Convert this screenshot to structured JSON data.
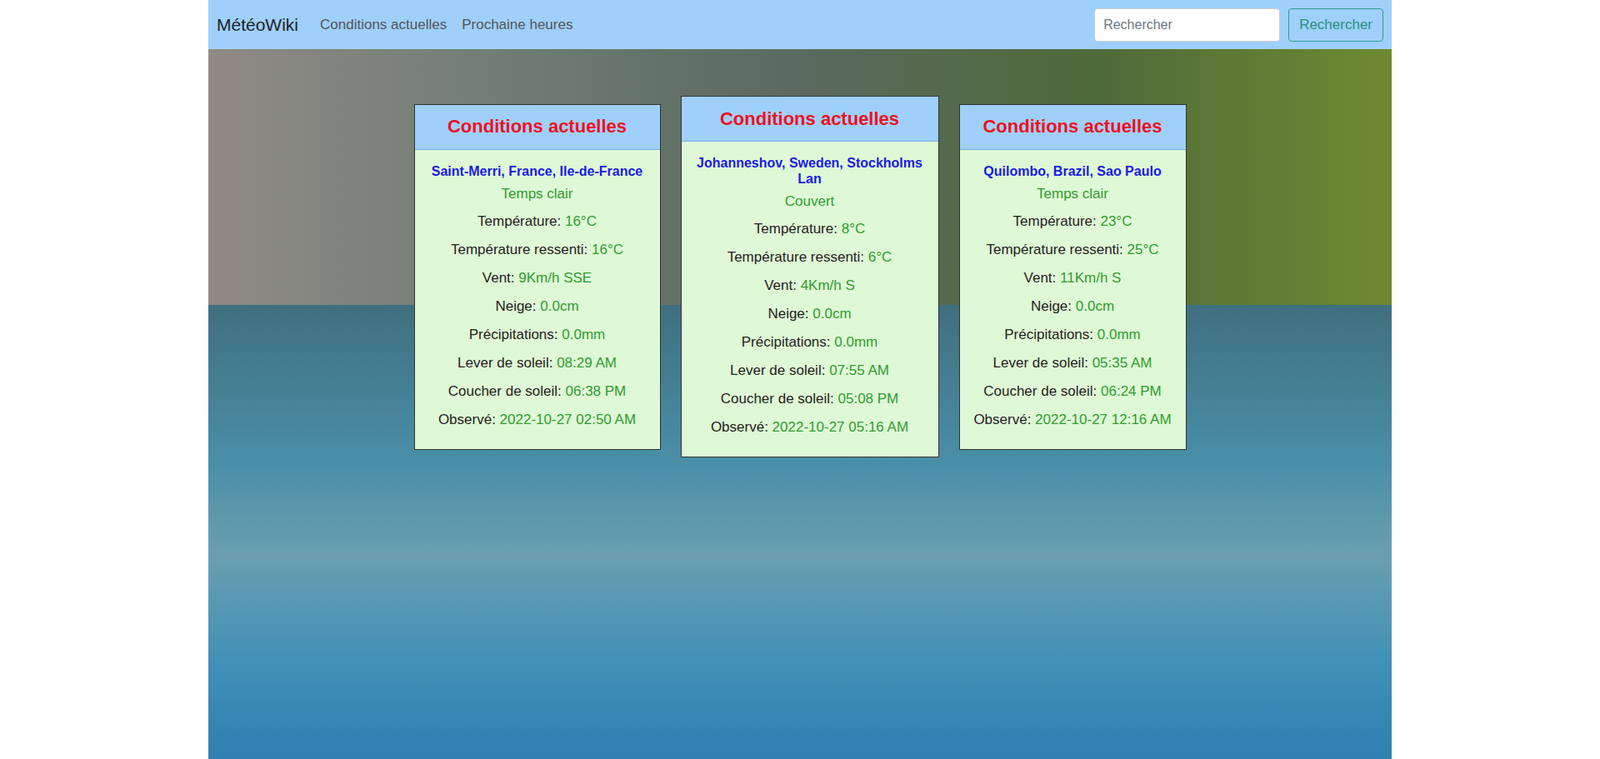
{
  "navbar": {
    "brand": "MétéoWiki",
    "links": [
      "Conditions actuelles",
      "Prochaine heures"
    ]
  },
  "search": {
    "placeholder": "Rechercher",
    "button": "Rechercher"
  },
  "cards": [
    {
      "title": "Conditions actuelles",
      "location": "Saint-Merri, France, Ile-de-France",
      "condition": "Temps clair",
      "fields": [
        {
          "label": "Température: ",
          "value": "16°C"
        },
        {
          "label": "Température ressenti: ",
          "value": "16°C"
        },
        {
          "label": "Vent: ",
          "value": "9Km/h SSE"
        },
        {
          "label": "Neige: ",
          "value": "0.0cm"
        },
        {
          "label": "Précipitations: ",
          "value": "0.0mm"
        },
        {
          "label": "Lever de soleil: ",
          "value": "08:29 AM"
        },
        {
          "label": "Coucher de soleil: ",
          "value": "06:38 PM"
        },
        {
          "label": "Observé: ",
          "value": "2022-10-27 02:50 AM"
        }
      ]
    },
    {
      "title": "Conditions actuelles",
      "location": "Johanneshov, Sweden, Stockholms Lan",
      "condition": "Couvert",
      "fields": [
        {
          "label": "Température: ",
          "value": "8°C"
        },
        {
          "label": "Température ressenti: ",
          "value": "6°C"
        },
        {
          "label": "Vent: ",
          "value": "4Km/h S"
        },
        {
          "label": "Neige: ",
          "value": "0.0cm"
        },
        {
          "label": "Précipitations: ",
          "value": "0.0mm"
        },
        {
          "label": "Lever de soleil: ",
          "value": "07:55 AM"
        },
        {
          "label": "Coucher de soleil: ",
          "value": "05:08 PM"
        },
        {
          "label": "Observé: ",
          "value": "2022-10-27 05:16 AM"
        }
      ]
    },
    {
      "title": "Conditions actuelles",
      "location": "Quilombo, Brazil, Sao Paulo",
      "condition": "Temps clair",
      "fields": [
        {
          "label": "Température: ",
          "value": "23°C"
        },
        {
          "label": "Température ressenti: ",
          "value": "25°C"
        },
        {
          "label": "Vent: ",
          "value": "11Km/h S"
        },
        {
          "label": "Neige: ",
          "value": "0.0cm"
        },
        {
          "label": "Précipitations: ",
          "value": "0.0mm"
        },
        {
          "label": "Lever de soleil: ",
          "value": "05:35 AM"
        },
        {
          "label": "Coucher de soleil: ",
          "value": "06:24 PM"
        },
        {
          "label": "Observé: ",
          "value": "2022-10-27 12:16 AM"
        }
      ]
    }
  ]
}
